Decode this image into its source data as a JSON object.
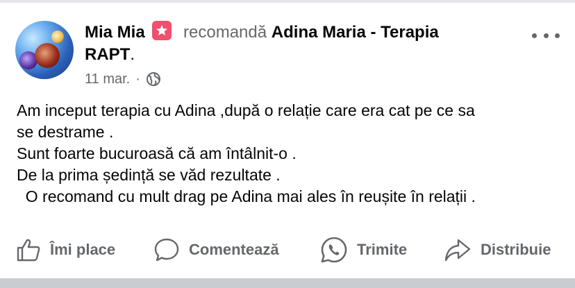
{
  "post": {
    "author": "Mia Mia",
    "verb": "recomandă",
    "page_name_part1": "Adina Maria - Terapia",
    "page_name_part2": "RAPT",
    "page_name_end": ".",
    "date": "11 mar.",
    "separator": "·",
    "body_lines": [
      "Am inceput terapia cu Adina ,după o relație care era cat pe ce sa",
      "se destrame .",
      "Sunt foarte bucuroasă că am întâlnit-o .",
      "De la prima ședință se văd rezultate .",
      "  O recomand cu mult drag pe Adina mai ales în reușite în relații ."
    ]
  },
  "actions": {
    "like": "Îmi place",
    "comment": "Comentează",
    "send": "Trimite",
    "share": "Distribuie"
  },
  "colors": {
    "text_primary": "#050505",
    "text_secondary": "#65676b",
    "badge": "#f0506e"
  },
  "icons": [
    "recommendation-badge-icon",
    "globe-icon",
    "more-options-icon",
    "like-icon",
    "comment-icon",
    "whatsapp-icon",
    "share-icon"
  ]
}
